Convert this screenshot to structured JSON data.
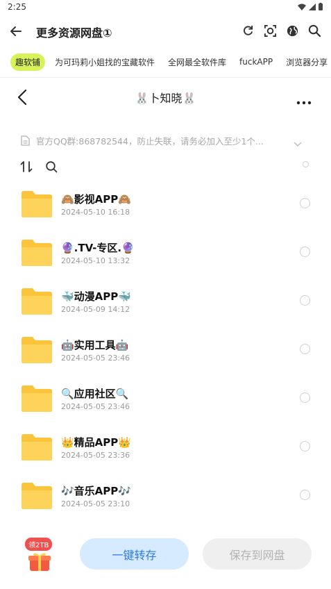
{
  "status": {
    "time": "2:25"
  },
  "appbar": {
    "title": "更多资源网盘①",
    "actions": [
      "refresh-icon",
      "screenshot-icon",
      "globe-icon",
      "search-icon"
    ]
  },
  "tabs": [
    {
      "label": "趣软铺",
      "active": true
    },
    {
      "label": "为可玛莉小姐找的宝藏软件",
      "active": false
    },
    {
      "label": "全网最全软件库",
      "active": false
    },
    {
      "label": "fuckAPP",
      "active": false
    },
    {
      "label": "浏览器分享",
      "active": false
    }
  ],
  "share": {
    "title": "🐰卜知晓🐰",
    "notice": "官方QQ群:868782544，防止失联，请务必加入至少1个..."
  },
  "files": [
    {
      "name": "🙈影视APP🙈",
      "date": "2024-05-10 16:18"
    },
    {
      "name": "🔮.TV-专区.🔮",
      "date": "2024-05-10 13:32"
    },
    {
      "name": "🐳动漫APP🐳",
      "date": "2024-05-09 14:12"
    },
    {
      "name": "🤖实用工具🤖",
      "date": "2024-05-05 23:46"
    },
    {
      "name": "🔍应用社区🔍",
      "date": "2024-05-05 23:46"
    },
    {
      "name": "👑精品APP👑",
      "date": "2024-05-05 23:36"
    },
    {
      "name": "🎶音乐APP🎶",
      "date": "2024-05-05 23:10"
    }
  ],
  "bottom": {
    "gift_badge": "领2TB",
    "primary_label": "一键转存",
    "secondary_label": "保存到网盘"
  },
  "colors": {
    "accent_tab": "#d8f35a",
    "primary_button_bg": "#d6ebff",
    "primary_button_text": "#2e7be0",
    "folder": "#fcc43a",
    "badge": "#f0504e"
  }
}
